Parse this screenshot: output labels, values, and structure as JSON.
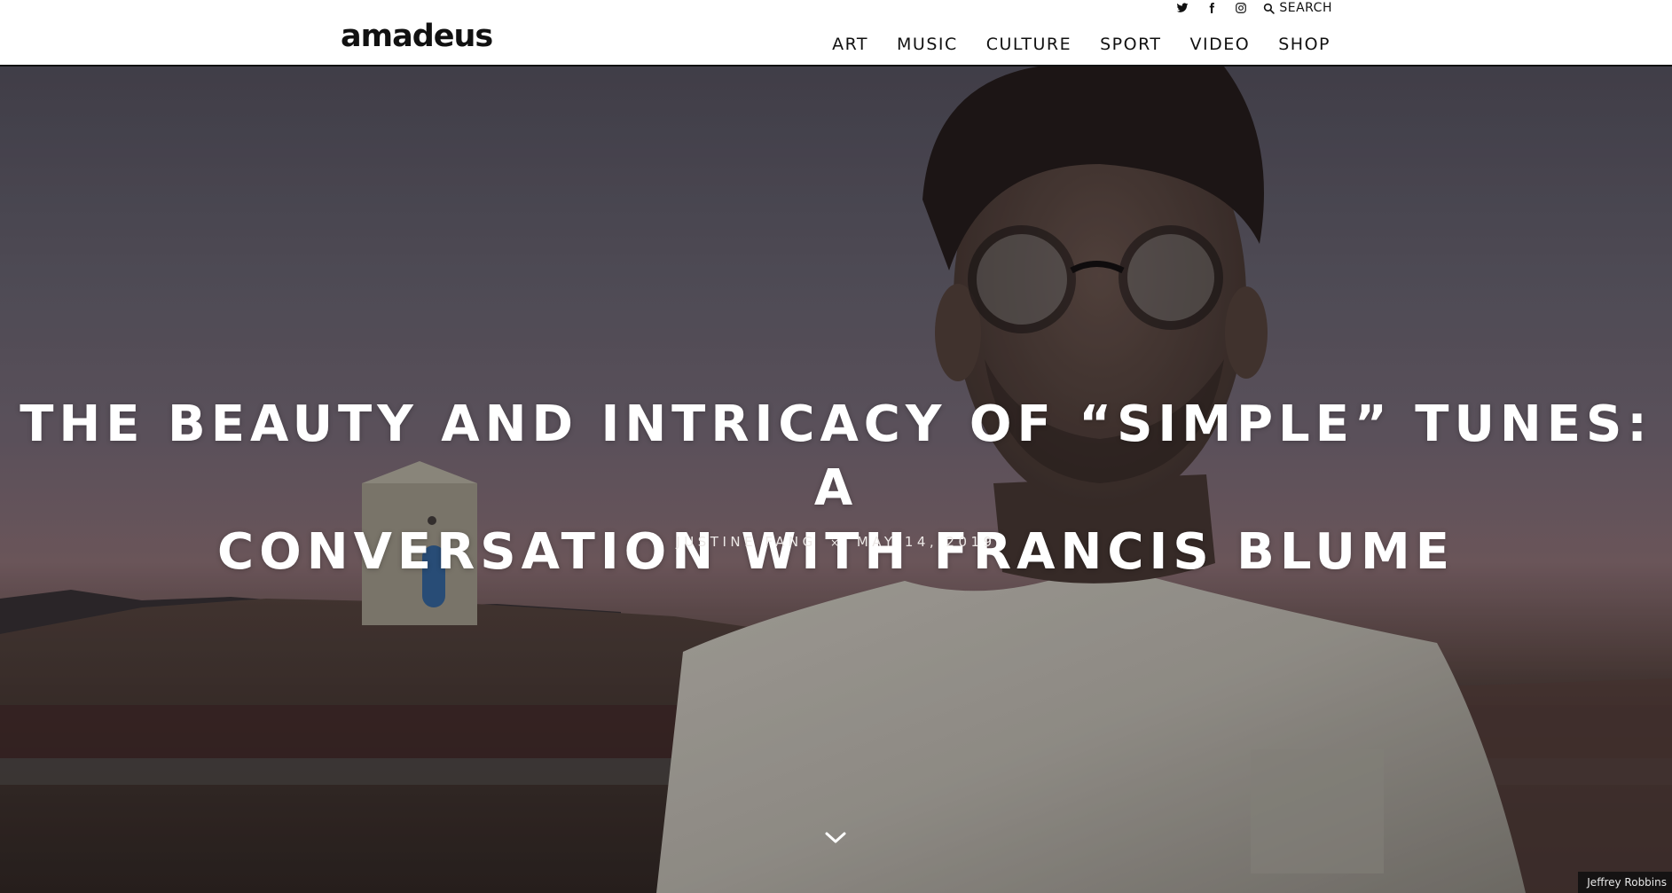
{
  "header": {
    "logo": "amadeus",
    "utility": {
      "icons": [
        "twitter-icon",
        "facebook-icon",
        "instagram-icon"
      ],
      "search_label": "SEARCH"
    },
    "nav": [
      {
        "label": "ART"
      },
      {
        "label": "MUSIC"
      },
      {
        "label": "CULTURE"
      },
      {
        "label": "SPORT"
      },
      {
        "label": "VIDEO"
      },
      {
        "label": "SHOP"
      }
    ]
  },
  "hero": {
    "title_line1": "THE BEAUTY AND INTRICACY OF “SIMPLE” TUNES: A",
    "title_line2": "CONVERSATION WITH FRANCIS BLUME",
    "author": "JUSTINE FANG",
    "separator": "×",
    "date": "MAY 14, 2019",
    "photo_credit": "Jeffrey Robbins",
    "scroll_icon": "chevron-down-icon"
  },
  "colors": {
    "header_bg": "#ffffff",
    "header_text": "#111111",
    "hero_text": "#ffffff"
  }
}
